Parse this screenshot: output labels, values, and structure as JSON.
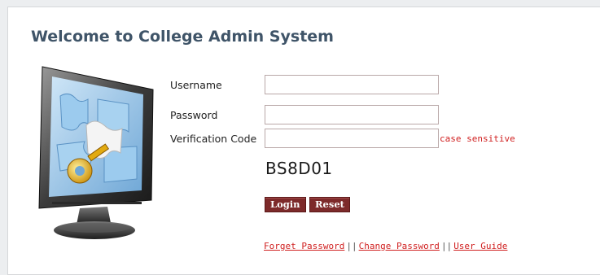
{
  "page": {
    "title": "Welcome to College Admin System"
  },
  "form": {
    "username_label": "Username",
    "username_value": "",
    "password_label": "Password",
    "password_value": "",
    "verification_label": "Verification Code",
    "verification_value": "",
    "case_hint": "case sensitive",
    "captcha_text": "BS8D01"
  },
  "buttons": {
    "login_label": "Login",
    "reset_label": "Reset"
  },
  "links": {
    "forget_password": "Forget Password",
    "change_password": "Change Password",
    "user_guide": "User Guide",
    "separator": "||"
  },
  "colors": {
    "accent": "#7d2a2a",
    "title": "#3f5468",
    "link": "#d02020"
  },
  "icons": {
    "illustration": "computer-monitor-key-icon"
  }
}
